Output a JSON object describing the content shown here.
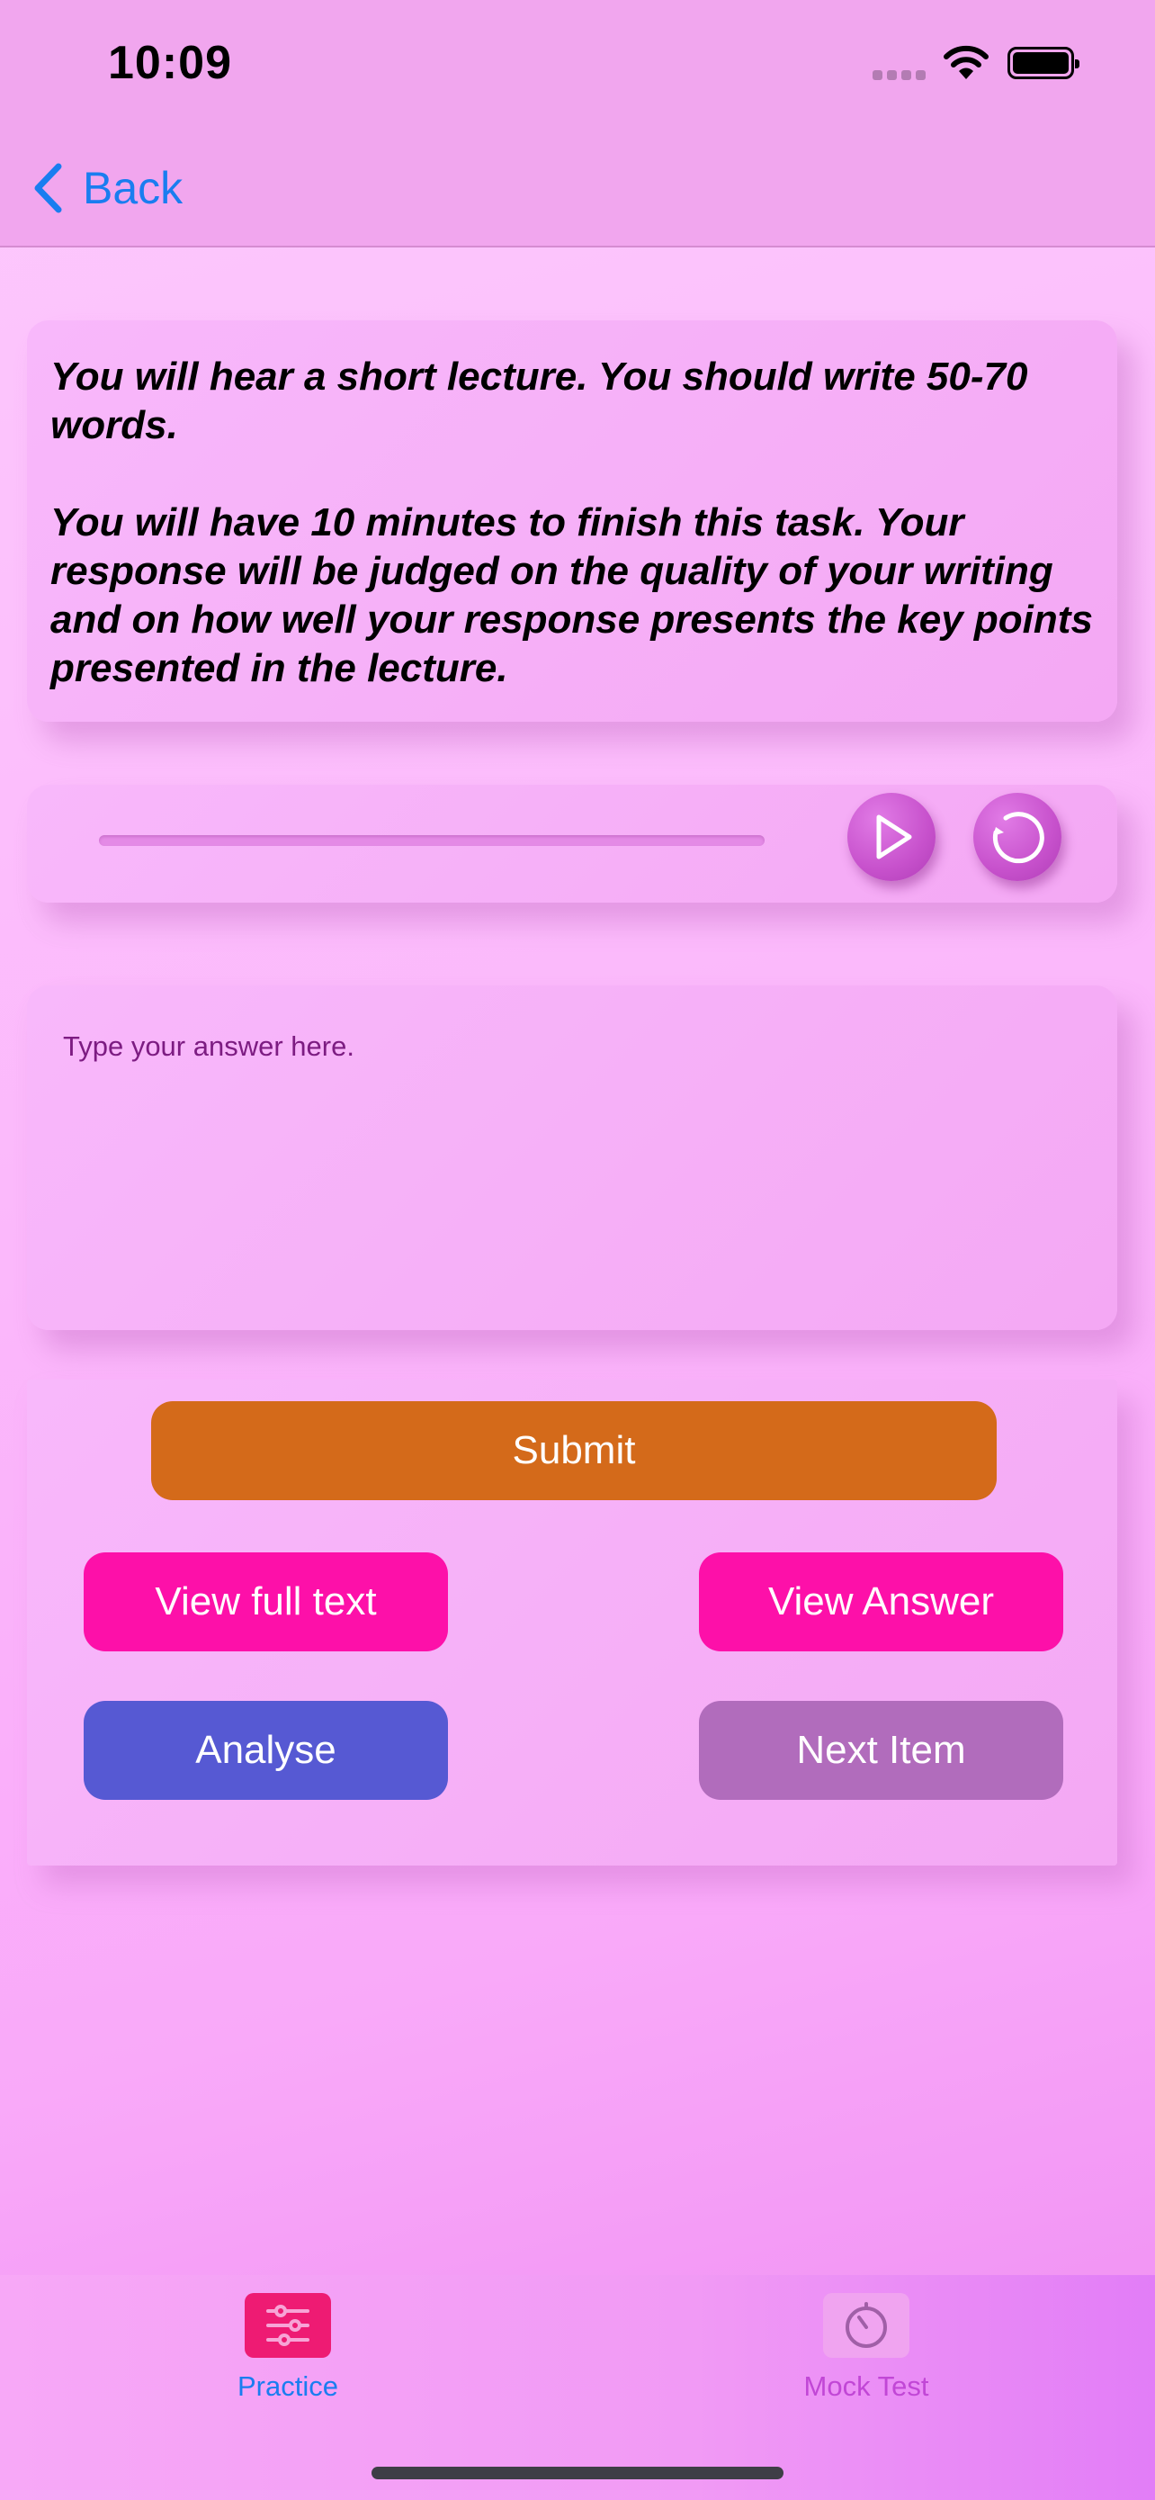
{
  "status_bar": {
    "time": "10:09"
  },
  "nav": {
    "back_label": "Back"
  },
  "instructions": {
    "paragraph_1": "You will hear a short lecture. You should write 50-70 words.",
    "paragraph_2": "You will have 10 minutes to finish this task. Your response will be judged on the quality of your writing and on how well your response presents the key points presented in the lecture."
  },
  "audio_player": {
    "progress": 0,
    "play_icon": "play-icon",
    "replay_icon": "replay-icon"
  },
  "answer": {
    "value": "",
    "placeholder": "Type your answer here."
  },
  "actions": {
    "submit_label": "Submit",
    "view_full_text_label": "View full text",
    "view_answer_label": "View Answer",
    "analyse_label": "Analyse",
    "next_item_label": "Next Item"
  },
  "colors": {
    "submit": "#d46a1a",
    "view_buttons": "#fd10a9",
    "analyse": "#5659d3",
    "next_item": "#b16cbc",
    "accent": "#1a7df0"
  },
  "tab_bar": {
    "tabs": [
      {
        "label": "Practice",
        "icon": "sliders-icon",
        "selected": true
      },
      {
        "label": "Mock Test",
        "icon": "timer-icon",
        "selected": false
      }
    ]
  }
}
